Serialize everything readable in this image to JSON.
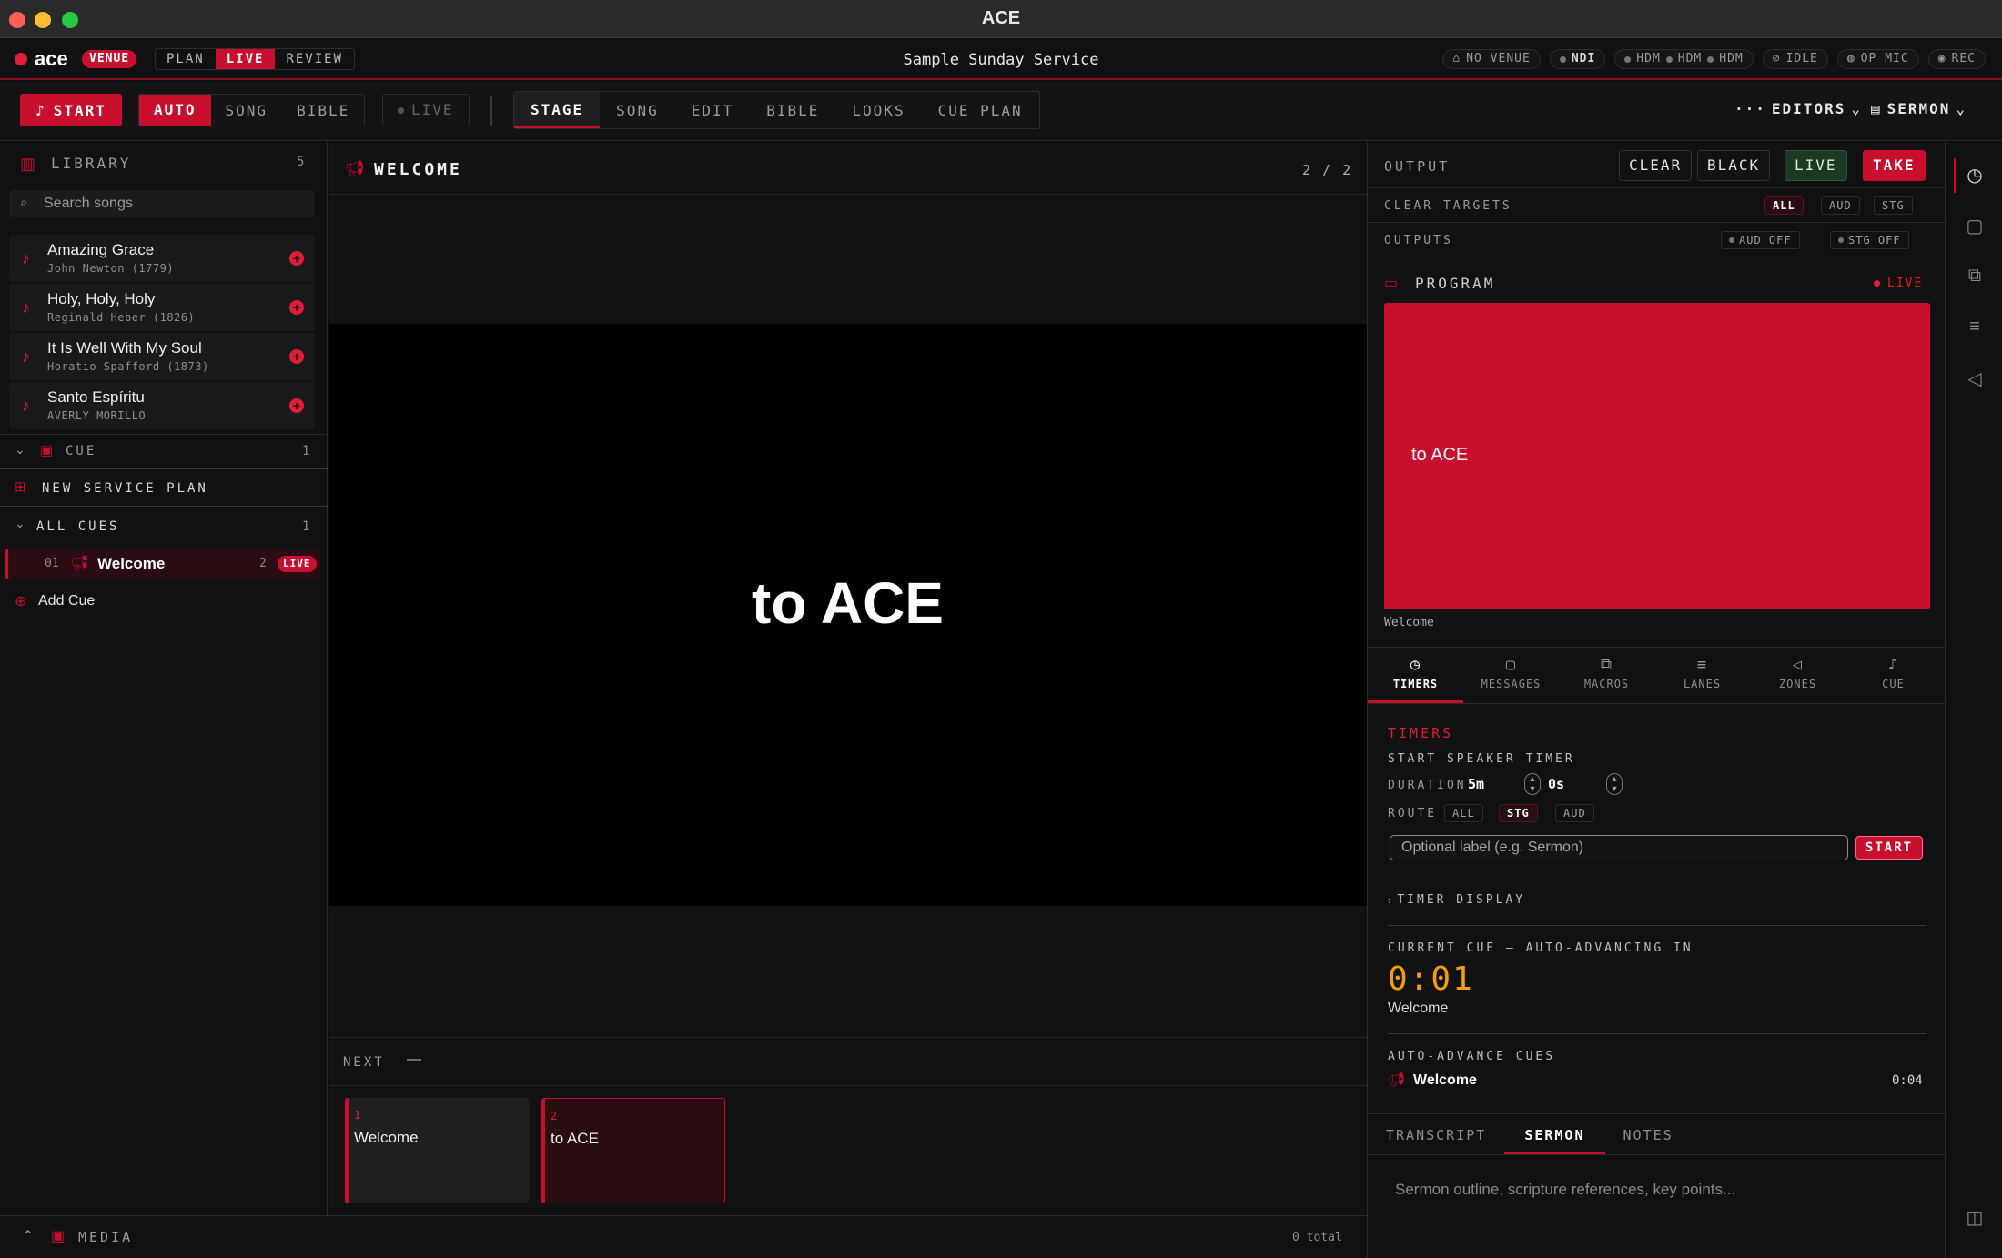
{
  "window": {
    "title": "ACE"
  },
  "nav": {
    "logo": "ace",
    "mode_badge": "VENUE",
    "modes": [
      "PLAN",
      "LIVE",
      "REVIEW"
    ],
    "active_mode": "LIVE",
    "service_title": "Sample Sunday Service",
    "status": {
      "venue": "NO VENUE",
      "ndi": "NDI",
      "hdm": [
        "HDM",
        "HDM",
        "HDM"
      ],
      "idle": "IDLE",
      "op_mic": "OP MIC",
      "rec": "REC"
    }
  },
  "toolbar": {
    "start_label": "START",
    "source_tabs": [
      "AUTO",
      "SONG",
      "BIBLE"
    ],
    "active_source": "AUTO",
    "live_toggle": "LIVE",
    "view_tabs": [
      "STAGE",
      "SONG",
      "EDIT",
      "BIBLE",
      "LOOKS",
      "CUE PLAN"
    ],
    "active_view": "STAGE",
    "editors_label": "EDITORS",
    "sermon_label": "SERMON"
  },
  "library": {
    "title": "LIBRARY",
    "count": "5",
    "search_placeholder": "Search songs",
    "songs": [
      {
        "title": "Amazing Grace",
        "author": "John Newton (1779)"
      },
      {
        "title": "Holy, Holy, Holy",
        "author": "Reginald Heber (1826)"
      },
      {
        "title": "It Is Well With My Soul",
        "author": "Horatio Spafford (1873)"
      },
      {
        "title": "Santo Espíritu",
        "author": "AVERLY MORILLO"
      }
    ],
    "cue_section": {
      "label": "CUE",
      "count": "1"
    },
    "new_service_plan": "NEW SERVICE PLAN",
    "all_cues": {
      "label": "ALL CUES",
      "count": "1"
    },
    "cues": [
      {
        "num": "01",
        "name": "Welcome",
        "slides": "2",
        "badge": "LIVE"
      }
    ],
    "add_cue": "Add Cue",
    "media": {
      "label": "MEDIA"
    }
  },
  "stage": {
    "cue_title": "WELCOME",
    "position": "2 / 2",
    "slide_text": "to ACE",
    "next_label": "NEXT",
    "next_value": "—",
    "slides": [
      {
        "num": "1",
        "text": "Welcome"
      },
      {
        "num": "2",
        "text": "to ACE"
      }
    ],
    "total": "0 total"
  },
  "output": {
    "title": "OUTPUT",
    "buttons": {
      "clear": "CLEAR",
      "black": "BLACK",
      "live": "LIVE",
      "take": "TAKE"
    },
    "clear_targets": {
      "label": "CLEAR TARGETS",
      "options": [
        "ALL",
        "AUD",
        "STG"
      ],
      "active": "ALL"
    },
    "outputs": {
      "label": "OUTPUTS",
      "aud": "AUD OFF",
      "stg": "STG OFF"
    },
    "program": {
      "label": "PROGRAM",
      "status": "LIVE",
      "preview_text": "to ACE",
      "caption": "Welcome"
    },
    "tabs": [
      "TIMERS",
      "MESSAGES",
      "MACROS",
      "LANES",
      "ZONES",
      "CUE"
    ],
    "active_tab": "TIMERS",
    "timers": {
      "heading": "TIMERS",
      "subheading": "START SPEAKER TIMER",
      "duration_label": "DURATION",
      "minutes": "5m",
      "seconds": "0s",
      "route_label": "ROUTE",
      "routes": [
        "ALL",
        "STG",
        "AUD"
      ],
      "active_route": "STG",
      "label_placeholder": "Optional label (e.g. Sermon)",
      "start": "START",
      "timer_display": "TIMER DISPLAY",
      "current_cue_label": "CURRENT CUE — AUTO-ADVANCING IN",
      "countdown": "0:01",
      "current_cue_name": "Welcome",
      "auto_advance_label": "AUTO-ADVANCE CUES",
      "auto_advance_item": {
        "name": "Welcome",
        "time": "0:04"
      }
    },
    "bottom_tabs": [
      "TRANSCRIPT",
      "SERMON",
      "NOTES"
    ],
    "active_bottom_tab": "SERMON",
    "sermon_placeholder": "Sermon outline, scripture references, key points..."
  },
  "colors": {
    "accent": "#c8102e",
    "countdown": "#f59e0b",
    "live_green": "#1f4d2a"
  }
}
